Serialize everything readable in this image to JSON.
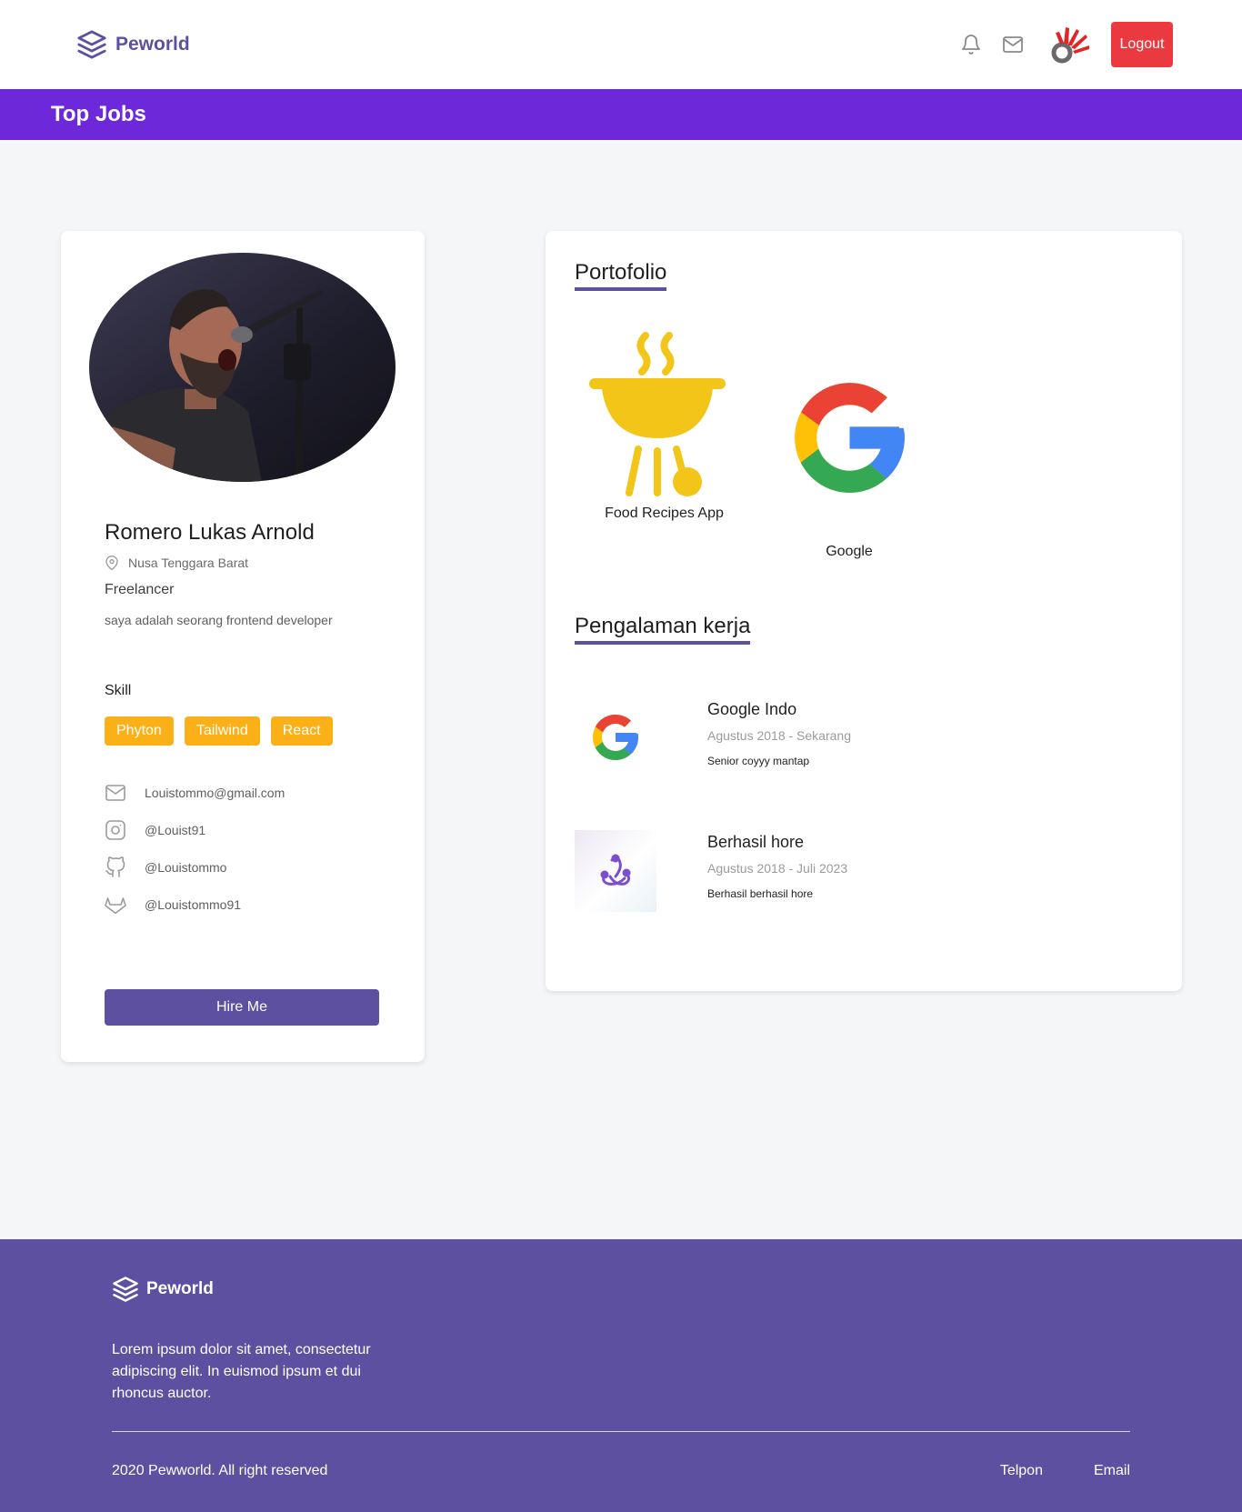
{
  "navbar": {
    "brand": "Peworld",
    "logout_label": "Logout"
  },
  "banner": {
    "title": "Top Jobs"
  },
  "profile": {
    "name": "Romero Lukas Arnold",
    "location": "Nusa Tenggara Barat",
    "role": "Freelancer",
    "bio": "saya adalah seorang frontend developer",
    "skill_title": "Skill",
    "skills": [
      "Phyton",
      "Tailwind",
      "React"
    ],
    "contacts": {
      "email": "Louistommo@gmail.com",
      "instagram": "@Louist91",
      "github": "@Louistommo",
      "gitlab": "@Louistommo91"
    },
    "hire_label": "Hire Me"
  },
  "portfolio": {
    "title": "Portofolio",
    "items": [
      {
        "label": "Food Recipes App",
        "icon": "grill-icon"
      },
      {
        "label": "Google",
        "icon": "google-logo-icon"
      }
    ]
  },
  "experience": {
    "title": "Pengalaman kerja",
    "items": [
      {
        "company": "Google Indo",
        "dates": "Agustus 2018 - Sekarang",
        "description": "Senior coyyy mantap",
        "icon": "google-logo-icon"
      },
      {
        "company": "Berhasil hore",
        "dates": "Agustus 2018 - Juli 2023",
        "description": "Berhasil berhasil hore",
        "icon": "redux-icon"
      }
    ]
  },
  "footer": {
    "brand": "Peworld",
    "description": "Lorem ipsum dolor sit amet, consectetur adipiscing elit. In euismod ipsum et dui rhoncus auctor.",
    "copyright": "2020 Pewworld. All right reserved",
    "links": [
      "Telpon",
      "Email"
    ]
  },
  "colors": {
    "brand_purple": "#5e50a1",
    "banner_purple": "#6d28d9",
    "logout_red": "#ea3a3f",
    "skill_orange": "#fbb017"
  }
}
